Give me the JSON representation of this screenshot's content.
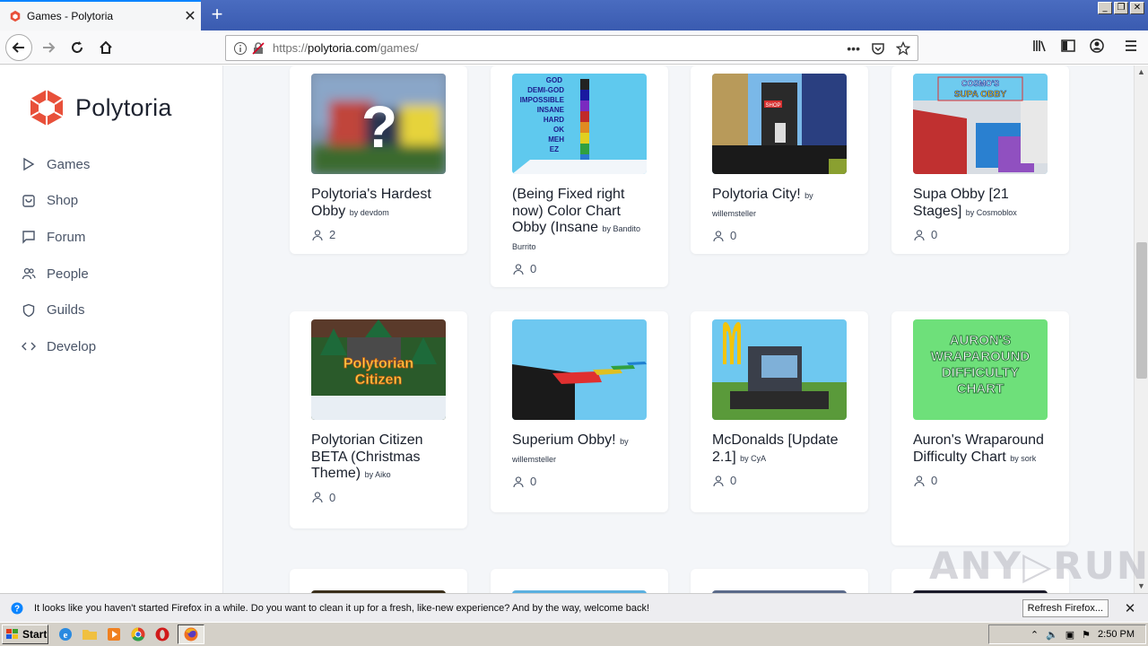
{
  "browser": {
    "tab_title": "Games - Polytoria",
    "url_prefix": "https://",
    "url_host": "polytoria.com",
    "url_path": "/games/",
    "more_icon": "•••"
  },
  "sidebar": {
    "brand": "Polytoria",
    "items": [
      {
        "label": "Games",
        "icon": "play-icon"
      },
      {
        "label": "Shop",
        "icon": "shop-icon"
      },
      {
        "label": "Forum",
        "icon": "chat-icon"
      },
      {
        "label": "People",
        "icon": "people-icon"
      },
      {
        "label": "Guilds",
        "icon": "shield-icon"
      },
      {
        "label": "Develop",
        "icon": "code-icon"
      }
    ]
  },
  "games": [
    {
      "title": "Polytoria's Hardest Obby",
      "by": "by devdom",
      "players": "2"
    },
    {
      "title": "(Being Fixed right now) Color Chart Obby (Insane",
      "by": "by Bandito Burrito",
      "players": "0"
    },
    {
      "title": "Polytoria City!",
      "by": "by willemsteller",
      "players": "0"
    },
    {
      "title": "Supa Obby [21 Stages]",
      "by": "by Cosmoblox",
      "players": "0"
    },
    {
      "title": "Polytorian Citizen BETA (Christmas Theme)",
      "by": "by Aiko",
      "players": "0"
    },
    {
      "title": "Superium Obby!",
      "by": "by willemsteller",
      "players": "0"
    },
    {
      "title": "McDonalds [Update 2.1]",
      "by": "by CyA",
      "players": "0"
    },
    {
      "title": "Auron's Wraparound Difficulty Chart",
      "by": "by sork",
      "players": "0"
    }
  ],
  "thumb_text": {
    "mystery": "?",
    "color_chart": [
      "GOD",
      "DEMI-GOD",
      "IMPOSSIBLE",
      "INSANE",
      "HARD",
      "OK",
      "MEH",
      "EZ"
    ],
    "city_sign": "SHOP",
    "supa": [
      "COSMO'S",
      "SUPA OBBY"
    ],
    "citizen": [
      "Polytorian",
      "Citizen"
    ],
    "auron": [
      "AURON'S",
      "WRAPAROUND",
      "DIFFICULTY",
      "CHART"
    ]
  },
  "notification": {
    "message": "It looks like you haven't started Firefox in a while. Do you want to clean it up for a fresh, like-new experience? And by the way, welcome back!",
    "refresh_label": "Refresh Firefox..."
  },
  "taskbar": {
    "start_label": "Start",
    "clock": "2:50 PM"
  },
  "watermark": "ANY▷RUN",
  "colors": {
    "brand": "#e8503a",
    "page_bg": "#f4f6f9"
  }
}
